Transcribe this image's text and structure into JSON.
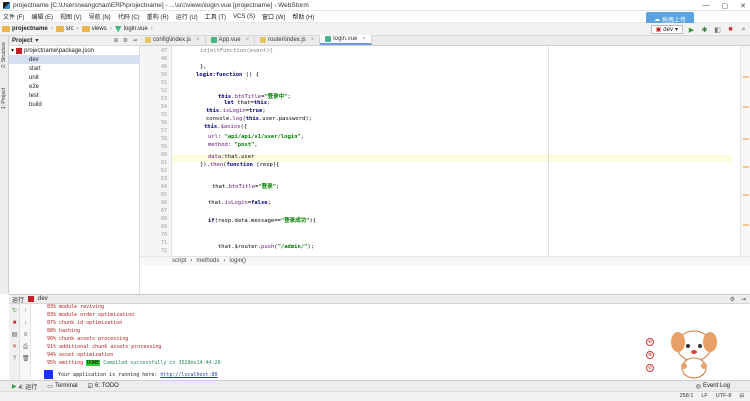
{
  "window": {
    "title": "projectname [C:\\Users\\wangchao\\ERP\\projectname] - ...\\src\\views\\login.vue [projectname] - WebStorm",
    "controls": [
      "—",
      "▢",
      "✕"
    ]
  },
  "menu": [
    "文件 (F)",
    "编辑 (E)",
    "视图 (V)",
    "导航 (N)",
    "代码 (C)",
    "重构 (R)",
    "运行 (U)",
    "工具 (T)",
    "VCS (S)",
    "窗口 (W)",
    "帮助 (H)"
  ],
  "breadcrumb": [
    "projectname",
    "src",
    "views",
    "login.vue"
  ],
  "cloud_label": "拖拽上传",
  "run_config": "dev",
  "project_panel": {
    "header": "Project",
    "root": "projectname",
    "root_path": "projectname\\package.json",
    "items": [
      "dev",
      "start",
      "unit",
      "e2e",
      "test",
      "build"
    ]
  },
  "left_strip": {
    "structure": "2: Structure",
    "project": "1: Project",
    "favorites": "2: Favorites",
    "npm": "npm"
  },
  "tabs": [
    {
      "label": "config\\index.js",
      "color": "#e2c75b"
    },
    {
      "label": "App.vue",
      "color": "#41b883"
    },
    {
      "label": "router\\index.js",
      "color": "#e2c75b"
    },
    {
      "label": "login.vue",
      "color": "#41b883"
    }
  ],
  "line_numbers": [
    "47",
    "48",
    "49",
    "50",
    "51",
    "52",
    "53",
    "54",
    "55",
    "56",
    "57",
    "58",
    "59",
    "60",
    "61",
    "62",
    "63",
    "64",
    "65",
    "66",
    "67",
    "68",
    "69",
    "70",
    "71",
    "72"
  ],
  "code_crumbs": [
    "script",
    "methods",
    "login()"
  ],
  "run_panel": {
    "title": "运行",
    "config": "dev",
    "lines": [
      "83% module reviving",
      "83% module order optimization",
      "87% chunk id optimization",
      "88% hashing",
      "90% chunk assets processing",
      "91% additional chunk assets processing",
      "94% asset optimization",
      "95% emitting"
    ],
    "done_badge": "DONE",
    "compiled": " Compiled successfully in 3528ms14:44:28",
    "running_text": " Your application is running here: ",
    "url": "http://localhost:80"
  },
  "bottom_tabs": [
    "4: 运行",
    "Terminal",
    "6: TODO"
  ],
  "event_log": "Event Log",
  "status": [
    "258:1",
    "LF",
    "UTF-8",
    "⊟"
  ],
  "side_icons": [
    "⊕",
    "⊗",
    "⊘"
  ]
}
